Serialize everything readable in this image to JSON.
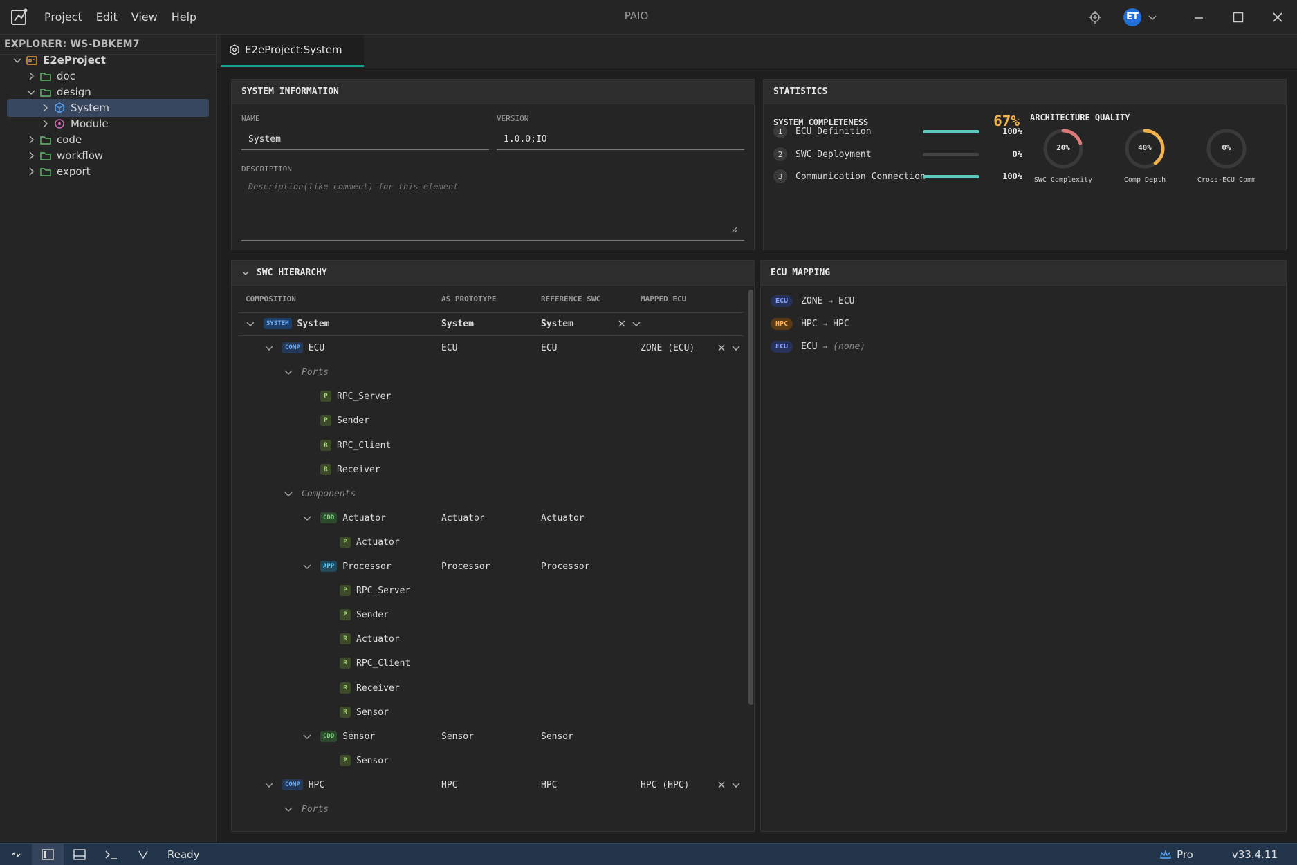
{
  "app": {
    "title": "PAIO",
    "menu": [
      "Project",
      "Edit",
      "View",
      "Help"
    ],
    "user_initials": "ET"
  },
  "explorer": {
    "title": "EXPLORER: WS-DBKEM7",
    "tree": [
      {
        "label": "E2eProject",
        "kind": "project",
        "expanded": true
      },
      {
        "label": "doc",
        "kind": "folder",
        "expanded": false
      },
      {
        "label": "design",
        "kind": "folder",
        "expanded": true
      },
      {
        "label": "System",
        "kind": "system",
        "expanded": false,
        "selected": true
      },
      {
        "label": "Module",
        "kind": "module",
        "expanded": false
      },
      {
        "label": "code",
        "kind": "folder",
        "expanded": false
      },
      {
        "label": "workflow",
        "kind": "folder",
        "expanded": false
      },
      {
        "label": "export",
        "kind": "folder",
        "expanded": false
      }
    ]
  },
  "tab": {
    "label": "E2eProject:System"
  },
  "system_info": {
    "title": "SYSTEM INFORMATION",
    "name_label": "NAME",
    "name_value": "System",
    "version_label": "VERSION",
    "version_value": "1.0.0;IO",
    "description_label": "DESCRIPTION",
    "description_placeholder": "Description(like comment) for this element"
  },
  "statistics": {
    "title": "STATISTICS",
    "completeness_title": "SYSTEM COMPLETENESS",
    "completeness_value": "67%",
    "items": [
      {
        "num": "1",
        "label": "ECU Definition",
        "value": "100%",
        "fraction": 1.0
      },
      {
        "num": "2",
        "label": "SWC Deployment",
        "value": "0%",
        "fraction": 0.0
      },
      {
        "num": "3",
        "label": "Communication Connection",
        "value": "100%",
        "fraction": 1.0
      }
    ],
    "quality_title": "ARCHITECTURE QUALITY",
    "gauges": [
      {
        "label": "SWC Complexity",
        "value": "20%",
        "fraction": 0.2,
        "color": "#e07a7a"
      },
      {
        "label": "Comp Depth",
        "value": "40%",
        "fraction": 0.4,
        "color": "#f2b34a"
      },
      {
        "label": "Cross-ECU Comm",
        "value": "0%",
        "fraction": 0.0,
        "color": "#5fc8bd"
      }
    ]
  },
  "swc": {
    "title": "SWC HIERARCHY",
    "columns": [
      "COMPOSITION",
      "AS PROTOTYPE",
      "REFERENCE SWC",
      "MAPPED ECU"
    ],
    "rows": [
      {
        "indent": 0,
        "chevron": true,
        "badge": "SYSTEM",
        "btype": "system",
        "name": "System",
        "proto": "System",
        "ref": "System",
        "ecu": "",
        "ecu_controls": true,
        "bold": true
      },
      {
        "indent": 1,
        "chevron": true,
        "badge": "COMP",
        "btype": "comp",
        "name": "ECU",
        "proto": "ECU",
        "ref": "ECU",
        "ecu": "ZONE (ECU)",
        "ecu_controls": true
      },
      {
        "indent": 2,
        "chevron": true,
        "group": true,
        "name": "Ports"
      },
      {
        "indent": 3,
        "badge": "P",
        "btype": "p",
        "name": "RPC_Server"
      },
      {
        "indent": 3,
        "badge": "P",
        "btype": "p",
        "name": "Sender"
      },
      {
        "indent": 3,
        "badge": "R",
        "btype": "r",
        "name": "RPC_Client"
      },
      {
        "indent": 3,
        "badge": "R",
        "btype": "r",
        "name": "Receiver"
      },
      {
        "indent": 2,
        "chevron": true,
        "group": true,
        "name": "Components"
      },
      {
        "indent": 3,
        "chevron": true,
        "badge": "CDD",
        "btype": "cdd",
        "name": "Actuator",
        "proto": "Actuator",
        "ref": "Actuator"
      },
      {
        "indent": 4,
        "badge": "P",
        "btype": "p",
        "name": "Actuator"
      },
      {
        "indent": 3,
        "chevron": true,
        "badge": "APP",
        "btype": "app",
        "name": "Processor",
        "proto": "Processor",
        "ref": "Processor"
      },
      {
        "indent": 4,
        "badge": "P",
        "btype": "p",
        "name": "RPC_Server"
      },
      {
        "indent": 4,
        "badge": "P",
        "btype": "p",
        "name": "Sender"
      },
      {
        "indent": 4,
        "badge": "R",
        "btype": "r",
        "name": "Actuator"
      },
      {
        "indent": 4,
        "badge": "R",
        "btype": "r",
        "name": "RPC_Client"
      },
      {
        "indent": 4,
        "badge": "R",
        "btype": "r",
        "name": "Receiver"
      },
      {
        "indent": 4,
        "badge": "R",
        "btype": "r",
        "name": "Sensor"
      },
      {
        "indent": 3,
        "chevron": true,
        "badge": "CDD",
        "btype": "cdd",
        "name": "Sensor",
        "proto": "Sensor",
        "ref": "Sensor"
      },
      {
        "indent": 4,
        "badge": "P",
        "btype": "p",
        "name": "Sensor"
      },
      {
        "indent": 1,
        "chevron": true,
        "badge": "COMP",
        "btype": "comp",
        "name": "HPC",
        "proto": "HPC",
        "ref": "HPC",
        "ecu": "HPC (HPC)",
        "ecu_controls": true
      },
      {
        "indent": 2,
        "chevron": true,
        "group": true,
        "name": "Ports"
      }
    ]
  },
  "ecu_mapping": {
    "title": "ECU MAPPING",
    "rows": [
      {
        "badge": "ECU",
        "btype": "ecu",
        "from": "ZONE",
        "to": "ECU",
        "none": false
      },
      {
        "badge": "HPC",
        "btype": "hpc",
        "from": "HPC",
        "to": "HPC",
        "none": false
      },
      {
        "badge": "ECU",
        "btype": "ecu",
        "from": "ECU",
        "to": "(none)",
        "none": true
      }
    ]
  },
  "statusbar": {
    "status": "Ready",
    "plan": "Pro",
    "version": "v33.4.11"
  }
}
